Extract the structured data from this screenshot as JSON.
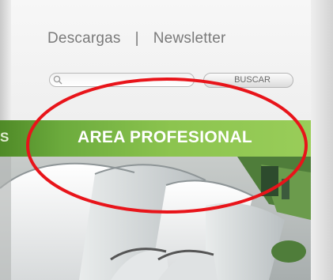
{
  "header": {
    "links": [
      {
        "label": "Descargas"
      },
      {
        "label": "Newsletter"
      }
    ],
    "separator": "|"
  },
  "search": {
    "value": "",
    "placeholder": "",
    "button_label": "BUSCAR"
  },
  "banner": {
    "left_fragment": "S",
    "title": "AREA PROFESIONAL"
  },
  "annotation": {
    "color": "#e8141a"
  },
  "icons": {
    "search": "search-icon"
  }
}
